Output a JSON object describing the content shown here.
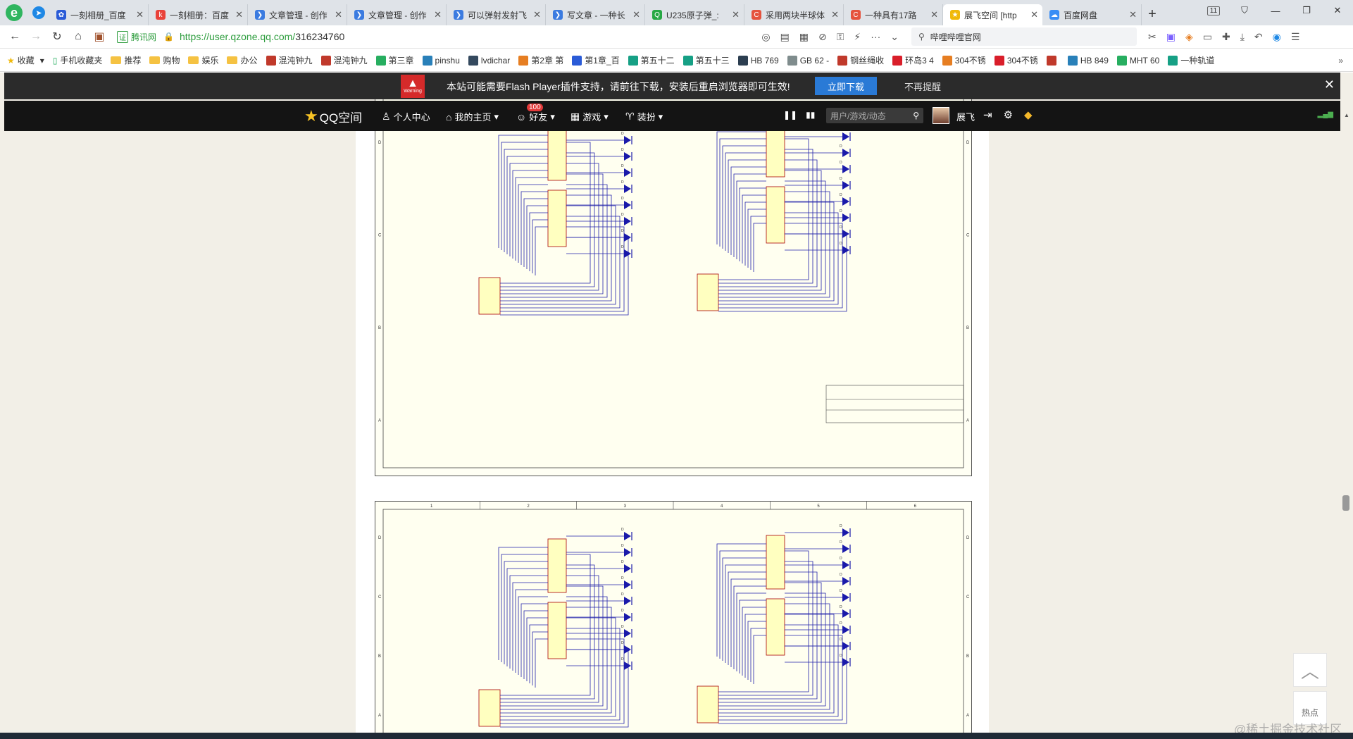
{
  "browser": {
    "tabs": [
      {
        "title": "一刻相册_百度",
        "color": "#2a5bd7",
        "icon": "paw-icon"
      },
      {
        "title": "一刻相册：百度",
        "color": "#e9423a",
        "icon": "k-icon"
      },
      {
        "title": "文章管理 - 创作",
        "color": "#3b7be0",
        "icon": "chevron-icon"
      },
      {
        "title": "文章管理 - 创作",
        "color": "#3b7be0",
        "icon": "chevron-icon"
      },
      {
        "title": "可以弹射发射飞",
        "color": "#3b7be0",
        "icon": "chevron-icon"
      },
      {
        "title": "写文章 - 一种长",
        "color": "#3b7be0",
        "icon": "chevron-icon"
      },
      {
        "title": "U235原子弹_:",
        "color": "#27a844",
        "icon": "search-icon"
      },
      {
        "title": "采用两块半球体",
        "color": "#e5533d",
        "icon": "c-icon"
      },
      {
        "title": "一种具有17路",
        "color": "#e5533d",
        "icon": "c-icon"
      },
      {
        "title": "展飞空间 [http",
        "color": "#f0b90b",
        "icon": "star-icon"
      },
      {
        "title": "百度网盘",
        "color": "#3a8ef5",
        "icon": "cloud-icon"
      }
    ],
    "active_tab_index": 9,
    "tab_count_badge": "11",
    "address": {
      "cert_label": "腾讯网",
      "url_host": "https://user.qzone.qq.com/",
      "url_path": "316234760"
    },
    "search_placeholder": "哔哩哔哩官网"
  },
  "bookmarks": [
    {
      "label": "收藏",
      "type": "star"
    },
    {
      "label": "手机收藏夹",
      "type": "phone"
    },
    {
      "label": "推荐",
      "type": "folder"
    },
    {
      "label": "购物",
      "type": "folder"
    },
    {
      "label": "娱乐",
      "type": "folder"
    },
    {
      "label": "办公",
      "type": "folder"
    },
    {
      "label": "混沌钟九",
      "type": "site",
      "color": "#c0392b"
    },
    {
      "label": "混沌钟九",
      "type": "site",
      "color": "#c0392b"
    },
    {
      "label": "第三章",
      "type": "site",
      "color": "#27ae60"
    },
    {
      "label": "pinshu",
      "type": "site",
      "color": "#2980b9"
    },
    {
      "label": "lvdichar",
      "type": "site",
      "color": "#34495e"
    },
    {
      "label": "第2章 第",
      "type": "site",
      "color": "#e67e22"
    },
    {
      "label": "第1章_百",
      "type": "site",
      "color": "#2a5bd7"
    },
    {
      "label": "第五十二",
      "type": "site",
      "color": "#16a085"
    },
    {
      "label": "第五十三",
      "type": "site",
      "color": "#16a085"
    },
    {
      "label": "HB 769",
      "type": "site",
      "color": "#2c3e50"
    },
    {
      "label": "GB 62 -",
      "type": "site",
      "color": "#7f8c8d"
    },
    {
      "label": "钢丝绳收",
      "type": "site",
      "color": "#c0392b"
    },
    {
      "label": "环岛3 4",
      "type": "site",
      "color": "#d91e2a"
    },
    {
      "label": "304不锈",
      "type": "site",
      "color": "#e67e22"
    },
    {
      "label": "304不锈",
      "type": "site",
      "color": "#d91e2a"
    },
    {
      "label": "",
      "type": "site",
      "color": "#c0392b"
    },
    {
      "label": "HB 849",
      "type": "site",
      "color": "#2980b9"
    },
    {
      "label": "MHT 60",
      "type": "site",
      "color": "#27ae60"
    },
    {
      "label": "一种轨道",
      "type": "site",
      "color": "#16a085"
    }
  ],
  "flash_notice": {
    "warning_label": "Warning",
    "message": "本站可能需要Flash Player插件支持，请前往下载，安装后重启浏览器即可生效!",
    "download_label": "立即下载",
    "dismiss_label": "不再提醒"
  },
  "qzone_nav": {
    "logo": "QQ空间",
    "items": [
      "个人中心",
      "我的主页",
      "好友",
      "游戏",
      "装扮"
    ],
    "friends_badge": "100",
    "search_placeholder": "用户/游戏/动态",
    "user_name": "展飞"
  },
  "schematics": {
    "ruler_numbers": [
      "1",
      "2",
      "3",
      "4",
      "5",
      "6"
    ],
    "row_letters": [
      "D",
      "C",
      "B",
      "A"
    ]
  },
  "side": {
    "hot_label": "热点",
    "watermark": "@稀土掘金技术社区"
  }
}
